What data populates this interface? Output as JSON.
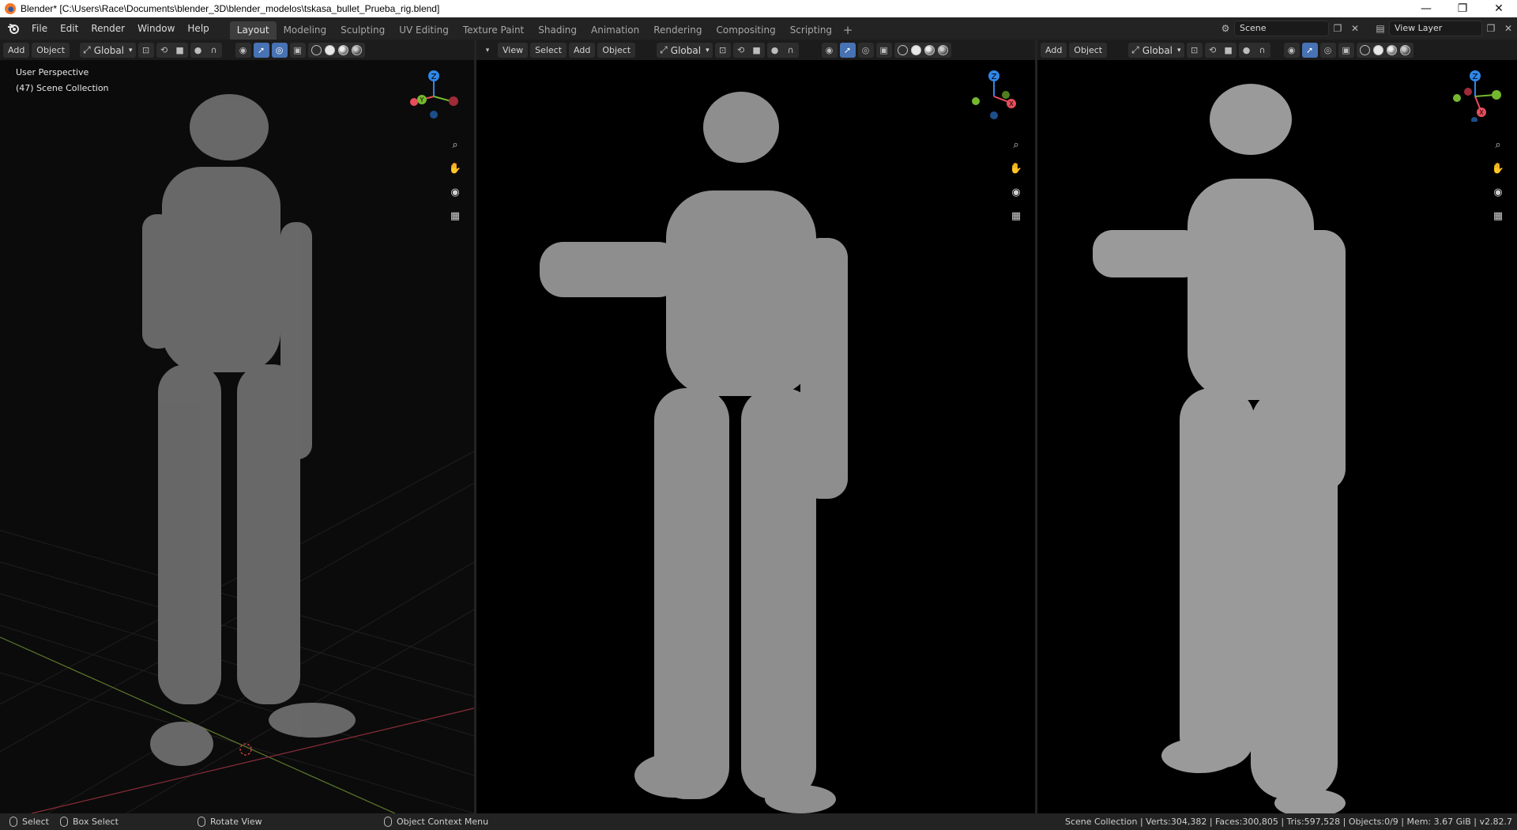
{
  "window": {
    "title": "Blender* [C:\\Users\\Race\\Documents\\blender_3D\\blender_modelos\\tskasa_bullet_Prueba_rig.blend]",
    "controls": [
      "—",
      "❐",
      "✕"
    ]
  },
  "menus": [
    "File",
    "Edit",
    "Render",
    "Window",
    "Help"
  ],
  "workspaces": {
    "tabs": [
      "Layout",
      "Modeling",
      "Sculpting",
      "UV Editing",
      "Texture Paint",
      "Shading",
      "Animation",
      "Rendering",
      "Compositing",
      "Scripting"
    ],
    "active": "Layout",
    "add": "+"
  },
  "scene": {
    "name": "Scene",
    "view_layer": "View Layer"
  },
  "viewport1": {
    "buttons": [
      "Add",
      "Object"
    ],
    "orientation": "Global",
    "overlay_line1": "User Perspective",
    "overlay_line2": "(47) Scene Collection"
  },
  "viewport2": {
    "buttons": [
      "View",
      "Select",
      "Add",
      "Object"
    ],
    "orientation": "Global"
  },
  "viewport3": {
    "buttons": [
      "Add",
      "Object"
    ],
    "orientation": "Global"
  },
  "gizmo": {
    "z": "Z",
    "y": "Y",
    "x": "X"
  },
  "colors": {
    "x_axis": "#e94c5b",
    "y_axis": "#75b82f",
    "z_axis": "#2f87e8",
    "accent": "#4772b3"
  },
  "icons": [
    "blender-logo-icon",
    "zoom-icon",
    "hand-icon",
    "camera-icon",
    "grid-icon"
  ],
  "statusbar": {
    "select": "Select",
    "box_select": "Box Select",
    "rotate_view": "Rotate View",
    "context_menu": "Object Context Menu",
    "stats": "Scene Collection | Verts:304,382 | Faces:300,805 | Tris:597,528 | Objects:0/9 | Mem: 3.67 GiB | v2.82.7"
  }
}
